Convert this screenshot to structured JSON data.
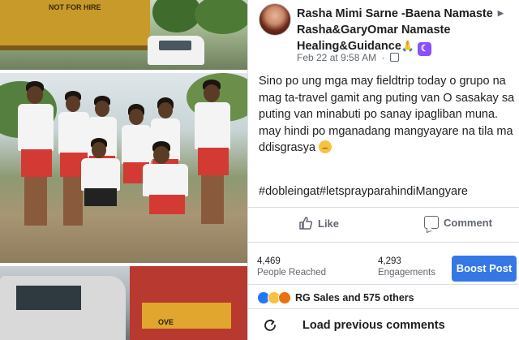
{
  "post": {
    "author_name": "Rasha Mimi Sarne -Baena",
    "target_page": "Namaste",
    "target_group": "Rasha&GaryOmar Namaste Healing&Guidance",
    "target_emoji": "🙏",
    "timestamp": "Feb 22 at 9:58 AM",
    "paragraphs": [
      "Sino po ung mga may fieldtrip today o grupo na mag ta-travel gamit ang puting van O sasakay sa puting van minabuti po sanay ipagliban muna.",
      "may hindi po mganadang mangyayare na tila ma ddisgrasya"
    ],
    "hashtags": "#dobleingat#letsprayparahindiMangyare",
    "actions": {
      "like_label": "Like",
      "comment_label": "Comment"
    },
    "stats": {
      "reach_value": "4,469",
      "reach_label": "People Reached",
      "engagement_value": "4,293",
      "engagement_label": "Engagements",
      "boost_label": "Boost Post"
    },
    "reactions_text": "RG Sales and 575 others",
    "load_previous_label": "Load previous comments"
  },
  "collage": {
    "top_truck_text": "NOT FOR HIRE",
    "bottom_truck_text": "OVE"
  },
  "colors": {
    "brand_blue": "#3578e5",
    "text_primary": "#1c1e21",
    "text_secondary": "#606770",
    "divider": "#dadde1"
  }
}
